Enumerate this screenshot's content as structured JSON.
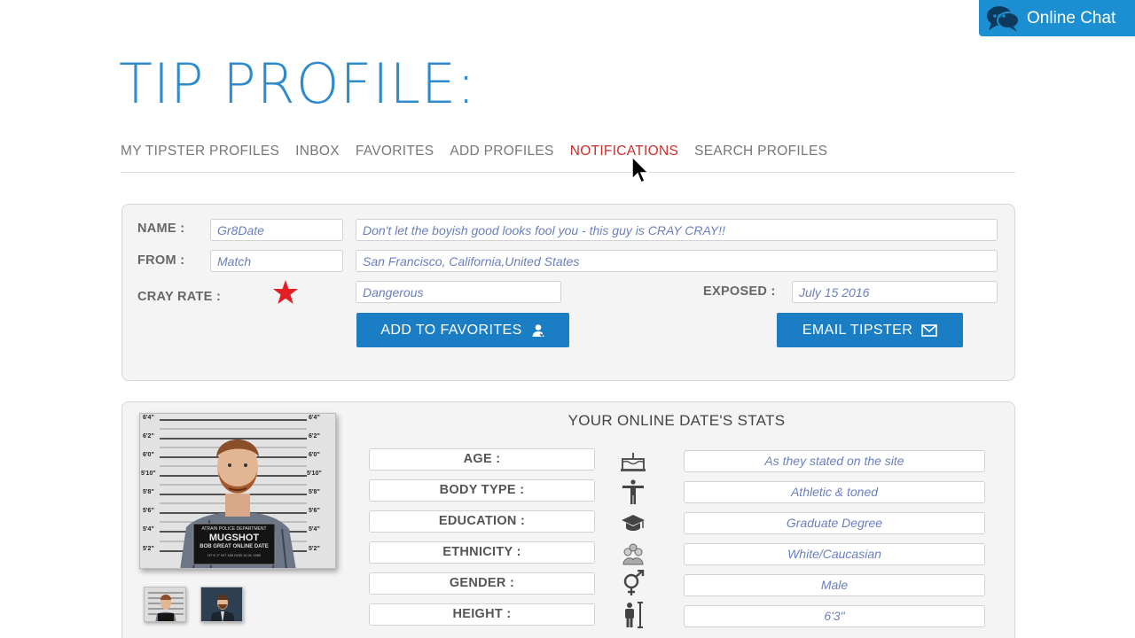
{
  "chat": {
    "label": "Online Chat",
    "icon": "chat-bubbles-icon"
  },
  "page": {
    "title": "TIP PROFILE:"
  },
  "nav": [
    {
      "label": "MY TIPSTER PROFILES",
      "active": false
    },
    {
      "label": "INBOX",
      "active": false
    },
    {
      "label": "FAVORITES",
      "active": false
    },
    {
      "label": "ADD PROFILES",
      "active": false
    },
    {
      "label": "NOTIFICATIONS",
      "active": true
    },
    {
      "label": "SEARCH PROFILES",
      "active": false
    }
  ],
  "profile": {
    "name_label": "NAME :",
    "name_value": "Gr8Date",
    "tagline": "Don't let the boyish good looks fool you - this guy is CRAY CRAY!!",
    "from_label": "FROM :",
    "from_value": "Match",
    "location": "San Francisco, California,United States",
    "cray_label": "CRAY RATE :",
    "cray_stars": 1,
    "cray_value": "Dangerous",
    "exposed_label": "EXPOSED :",
    "exposed_value": "July 15 2016",
    "add_favorites_label": "ADD TO FAVORITES",
    "email_tipster_label": "EMAIL TIPSTER"
  },
  "mugshot": {
    "heights": [
      "6'4\"",
      "6'2\"",
      "6'0\"",
      "5'10\"",
      "5'8\"",
      "5'6\"",
      "5'4\"",
      "5'2\""
    ],
    "board_top": "ATRAIN     POLICE DEPARTMENT",
    "board_main": "MUGSHOT",
    "board_sub": "BOB GREAT ONLINE DATE",
    "board_line": "HT 6' 2\"   WT 185   DOB 10.01.1985"
  },
  "stats": {
    "title": "YOUR ONLINE DATE'S STATS",
    "rows": [
      {
        "label": "AGE :",
        "icon": "birthday-cake-icon",
        "value": "As they stated on the site"
      },
      {
        "label": "BODY TYPE :",
        "icon": "body-figure-icon",
        "value": "Athletic & toned"
      },
      {
        "label": "EDUCATION :",
        "icon": "graduation-cap-icon",
        "value": "Graduate Degree"
      },
      {
        "label": "ETHNICITY :",
        "icon": "people-group-icon",
        "value": "White/Caucasian"
      },
      {
        "label": "GENDER :",
        "icon": "gender-symbol-icon",
        "value": "Male"
      },
      {
        "label": "HEIGHT :",
        "icon": "height-figure-icon",
        "value": "6'3\""
      }
    ]
  }
}
